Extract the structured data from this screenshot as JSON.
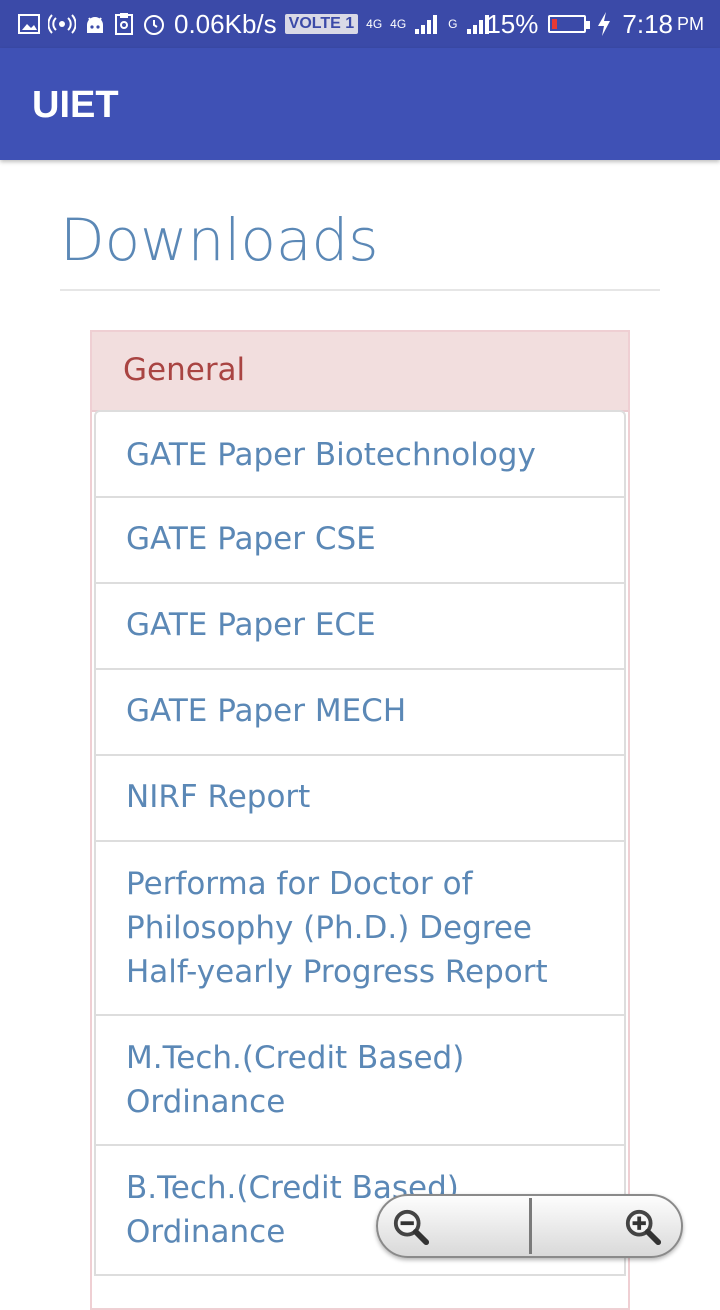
{
  "status_bar": {
    "speed": "0.06Kb/s",
    "volte": "VOLTE 1",
    "net1": "4G",
    "net2": "4G",
    "net3": "G",
    "battery": "15%",
    "battery_level_percent": 15,
    "time": "7:18",
    "ampm": "PM",
    "icons": [
      "image-icon",
      "hotspot-icon",
      "android-icon",
      "clipboard-icon",
      "alarm-icon",
      "signal-icon",
      "battery-icon",
      "charging-icon"
    ]
  },
  "app_bar": {
    "title": "UIET",
    "color": "#3f51b5"
  },
  "page": {
    "title": "Downloads"
  },
  "panel": {
    "heading": "General",
    "items": [
      {
        "label": "GATE Paper Biotechnology"
      },
      {
        "label": "GATE Paper CSE"
      },
      {
        "label": "GATE Paper ECE"
      },
      {
        "label": "GATE Paper MECH"
      },
      {
        "label": "NIRF Report"
      },
      {
        "label": "Performa for Doctor of Philosophy (Ph.D.) Degree Half-yearly Progress Report"
      },
      {
        "label": "M.Tech.(Credit Based) Ordinance"
      },
      {
        "label": "B.Tech.(Credit Based) Ordinance"
      }
    ]
  },
  "zoom_controls": {
    "out_icon": "zoom-out-icon",
    "in_icon": "zoom-in-icon"
  }
}
